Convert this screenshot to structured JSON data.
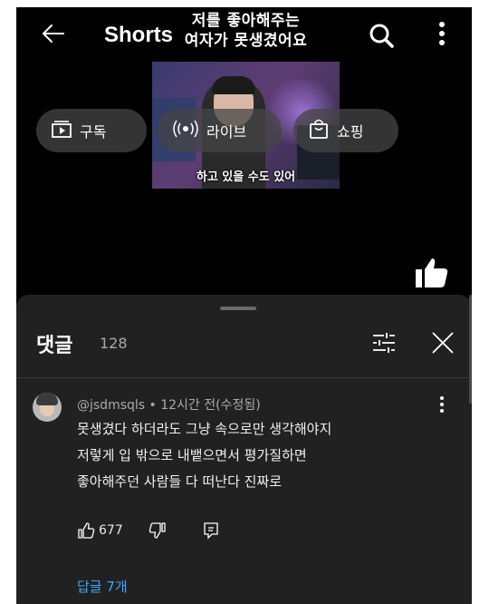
{
  "header": {
    "brand": "Shorts",
    "overlay_title_line1": "저를 좋아해주는",
    "overlay_title_line2": "여자가 못생겼어요",
    "video_caption": "하고 있을 수도 있어"
  },
  "chips": [
    {
      "label": "구독",
      "icon": "subscriptions-icon"
    },
    {
      "label": "라이브",
      "icon": "live-icon"
    },
    {
      "label": "쇼핑",
      "icon": "shopping-bag-icon"
    }
  ],
  "comments_panel": {
    "title": "댓글",
    "count": "128"
  },
  "comment": {
    "author_meta": "@jsdmsqls • 12시간 전(수정됨)",
    "lines": [
      "못생겼다 하더라도 그냥 속으로만 생각해야지",
      "저렇게 입 밖으로 내뱉으면서 평가질하면",
      "좋아해주던 사람들 다 떠난다 진짜로"
    ],
    "likes": "677",
    "replies_label": "답글 7개"
  },
  "colors": {
    "background": "#000000",
    "sheet": "#212121",
    "reply_link": "#3ea6ff"
  }
}
